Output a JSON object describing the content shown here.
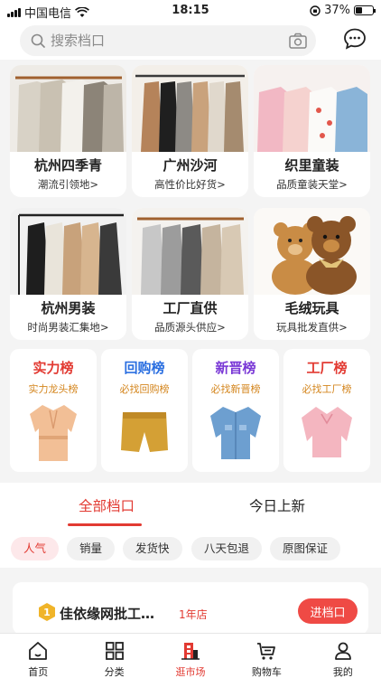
{
  "status_bar": {
    "carrier": "中国电信",
    "time": "18:15",
    "battery": "37%"
  },
  "search": {
    "placeholder": "搜索档口",
    "camera_icon": "camera-icon",
    "chat_icon": "chat-bubble-icon"
  },
  "markets": [
    {
      "name": "杭州四季青",
      "tagline": "潮流引领地>"
    },
    {
      "name": "广州沙河",
      "tagline": "高性价比好货>"
    },
    {
      "name": "织里童装",
      "tagline": "品质童装天堂>"
    },
    {
      "name": "杭州男装",
      "tagline": "时尚男装汇集地>"
    },
    {
      "name": "工厂直供",
      "tagline": "品质源头供应>"
    },
    {
      "name": "毛绒玩具",
      "tagline": "玩具批发直供>"
    }
  ],
  "rankings": [
    {
      "title": "实力榜",
      "subtitle": "实力龙头榜",
      "color": "#e23a32",
      "sub_color": "#d4861e"
    },
    {
      "title": "回购榜",
      "subtitle": "必找回购榜",
      "color": "#2b6fe0",
      "sub_color": "#d4861e"
    },
    {
      "title": "新晋榜",
      "subtitle": "必找新晋榜",
      "color": "#7a39d6",
      "sub_color": "#d4861e"
    },
    {
      "title": "工厂榜",
      "subtitle": "必找工厂榜",
      "color": "#e23a32",
      "sub_color": "#d4861e"
    }
  ],
  "tabs": [
    {
      "label": "全部档口",
      "active": true
    },
    {
      "label": "今日上新",
      "active": false
    }
  ],
  "filters": [
    {
      "label": "人气",
      "active": true
    },
    {
      "label": "销量",
      "active": false
    },
    {
      "label": "发货快",
      "active": false
    },
    {
      "label": "八天包退",
      "active": false
    },
    {
      "label": "原图保证",
      "active": false
    }
  ],
  "shop": {
    "rank": "1",
    "name": "佳依缘网批工…",
    "years": "1年店",
    "enter_label": "进档口"
  },
  "bottom_nav": [
    {
      "label": "首页",
      "icon": "home-icon",
      "active": false
    },
    {
      "label": "分类",
      "icon": "grid-icon",
      "active": false
    },
    {
      "label": "逛市场",
      "icon": "market-building-icon",
      "active": true
    },
    {
      "label": "购物车",
      "icon": "cart-icon",
      "active": false
    },
    {
      "label": "我的",
      "icon": "user-icon",
      "active": false
    }
  ],
  "colors": {
    "accent": "#e23a32",
    "page_bg": "#f4f4f4",
    "card_bg": "#ffffff"
  }
}
